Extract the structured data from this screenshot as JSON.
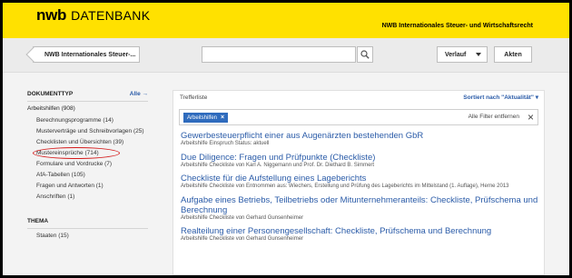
{
  "header": {
    "logo_main": "nwb",
    "logo_sub": "DATENBANK",
    "tagline": "NWB Internationales Steuer- und Wirtschaftsrecht"
  },
  "toolbar": {
    "breadcrumb_label": "NWB Internationales Steuer-...",
    "search_value": "",
    "verlauf_label": "Verlauf",
    "akten_label": "Akten"
  },
  "sidebar": {
    "doctype_heading": "DOKUMENTTYP",
    "alle_label": "Alle →",
    "group_label": "Arbeitshilfen (908)",
    "items": [
      {
        "label": "Berechnungsprogramme (14)"
      },
      {
        "label": "Musterverträge und Schreibvorlagen (25)"
      },
      {
        "label": "Checklisten und Übersichten (39)"
      },
      {
        "label": "Mustereinsprüche (714)"
      },
      {
        "label": "Formulare und Vordrucke (7)"
      },
      {
        "label": "AfA-Tabellen (105)"
      },
      {
        "label": "Fragen und Antworten (1)"
      },
      {
        "label": "Anschriften (1)"
      }
    ],
    "thema_heading": "THEMA",
    "thema_items": [
      {
        "label": "Staaten (15)"
      }
    ]
  },
  "main": {
    "title": "Trefferliste",
    "sort_label": "Sortiert nach \"Aktualität\" ▾",
    "filter_chip": "Arbeitshilfen",
    "filter_clear": "Alle Filter entfernen",
    "results": [
      {
        "title": "Gewerbesteuerpflicht einer aus Augenärzten bestehenden GbR",
        "sub": "Arbeitshilfe Einspruch Status: aktuell"
      },
      {
        "title": "Due Diligence: Fragen und Prüfpunkte (Checkliste)",
        "sub": "Arbeitshilfe Checkliste von Karl A. Niggemann und Prof. Dr. Diethard B. Simmert"
      },
      {
        "title": "Checkliste für die Aufstellung eines Lageberichts",
        "sub": "Arbeitshilfe Checkliste von Entnommen aus: Wiechers, Erstellung und Prüfung des Lageberichts im Mittelstand (1. Auflage), Herne 2013"
      },
      {
        "title": "Aufgabe eines Betriebs, Teilbetriebs oder Mitunternehmeranteils: Checkliste, Prüfschema und Berechnung",
        "sub": "Arbeitshilfe Checkliste von Gerhard Gunsenheimer"
      },
      {
        "title": "Realteilung einer Personengesellschaft: Checkliste, Prüfschema und Berechnung",
        "sub": "Arbeitshilfe Checkliste von Gerhard Gunsenheimer"
      }
    ]
  },
  "colors": {
    "brand_yellow": "#ffe100",
    "link_blue": "#2a5ba8",
    "chip_blue": "#2f6bbd",
    "annotation_red": "#d41b1b"
  }
}
